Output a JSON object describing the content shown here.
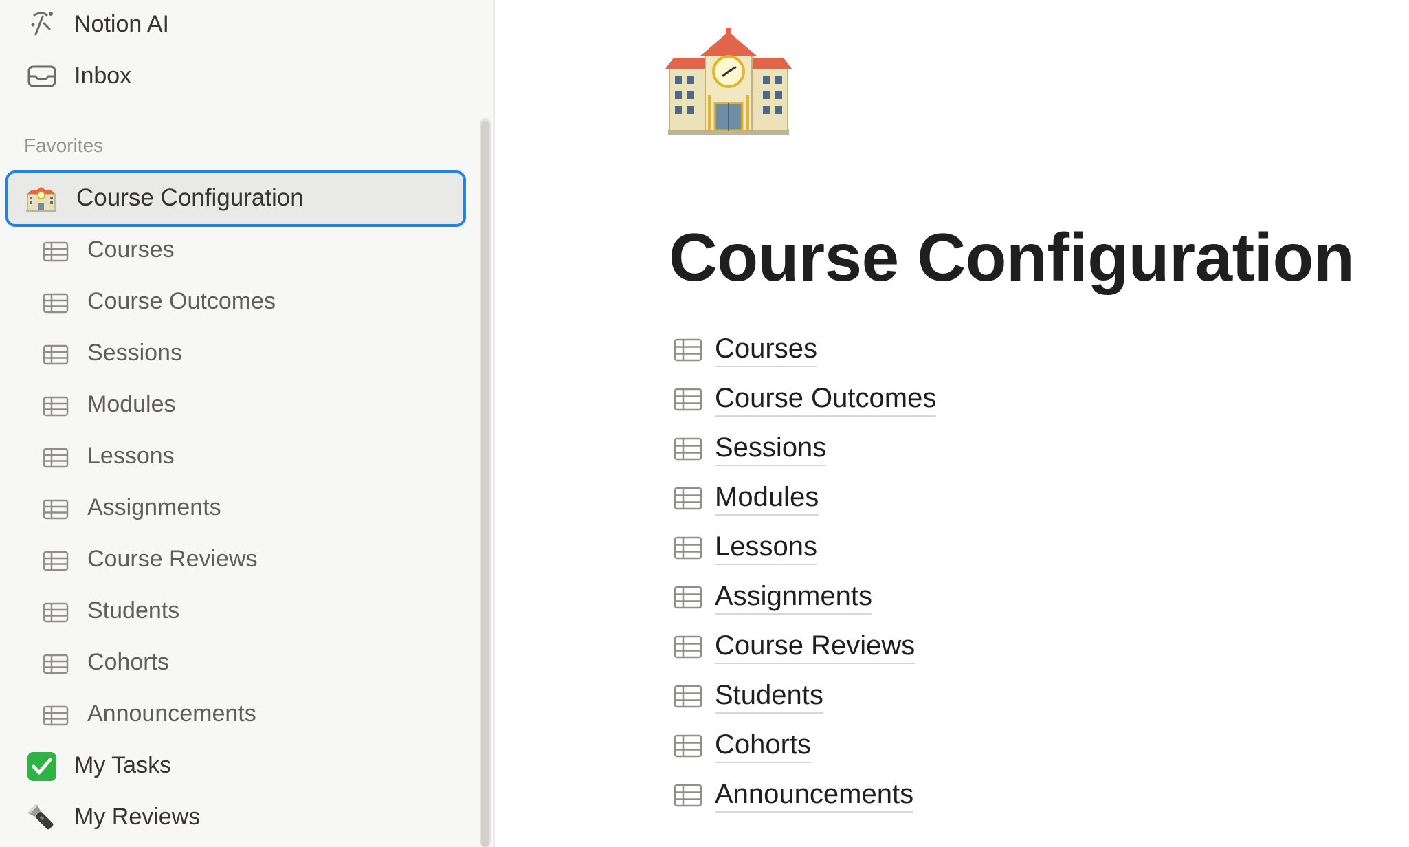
{
  "sidebar": {
    "top_items": [
      {
        "label": "Notion AI",
        "icon": "notion-ai-icon"
      },
      {
        "label": "Inbox",
        "icon": "inbox-icon"
      }
    ],
    "favorites_label": "Favorites",
    "favorite": {
      "label": "Course Configuration",
      "icon": "school-building-emoji"
    },
    "sub_items": [
      {
        "label": "Courses",
        "icon": "table-icon"
      },
      {
        "label": "Course Outcomes",
        "icon": "table-icon"
      },
      {
        "label": "Sessions",
        "icon": "table-icon"
      },
      {
        "label": "Modules",
        "icon": "table-icon"
      },
      {
        "label": "Lessons",
        "icon": "table-icon"
      },
      {
        "label": "Assignments",
        "icon": "table-icon"
      },
      {
        "label": "Course Reviews",
        "icon": "table-icon"
      },
      {
        "label": "Students",
        "icon": "table-icon"
      },
      {
        "label": "Cohorts",
        "icon": "table-icon"
      },
      {
        "label": "Announcements",
        "icon": "table-icon"
      }
    ],
    "bottom_items": [
      {
        "label": "My Tasks",
        "icon": "checkmark-emoji"
      },
      {
        "label": "My Reviews",
        "icon": "flashlight-emoji"
      }
    ]
  },
  "page": {
    "icon": "school-building-emoji",
    "title": "Course Configuration",
    "links": [
      {
        "label": "Courses",
        "icon": "table-icon"
      },
      {
        "label": "Course Outcomes",
        "icon": "table-icon"
      },
      {
        "label": "Sessions",
        "icon": "table-icon"
      },
      {
        "label": "Modules",
        "icon": "table-icon"
      },
      {
        "label": "Lessons",
        "icon": "table-icon"
      },
      {
        "label": "Assignments",
        "icon": "table-icon"
      },
      {
        "label": "Course Reviews",
        "icon": "table-icon"
      },
      {
        "label": "Students",
        "icon": "table-icon"
      },
      {
        "label": "Cohorts",
        "icon": "table-icon"
      },
      {
        "label": "Announcements",
        "icon": "table-icon"
      }
    ]
  },
  "colors": {
    "sidebar_bg": "#f7f7f5",
    "selection_border": "#2383e2",
    "text_primary": "#37352f",
    "text_secondary": "#5f5e5b",
    "section_label": "#91918e"
  }
}
